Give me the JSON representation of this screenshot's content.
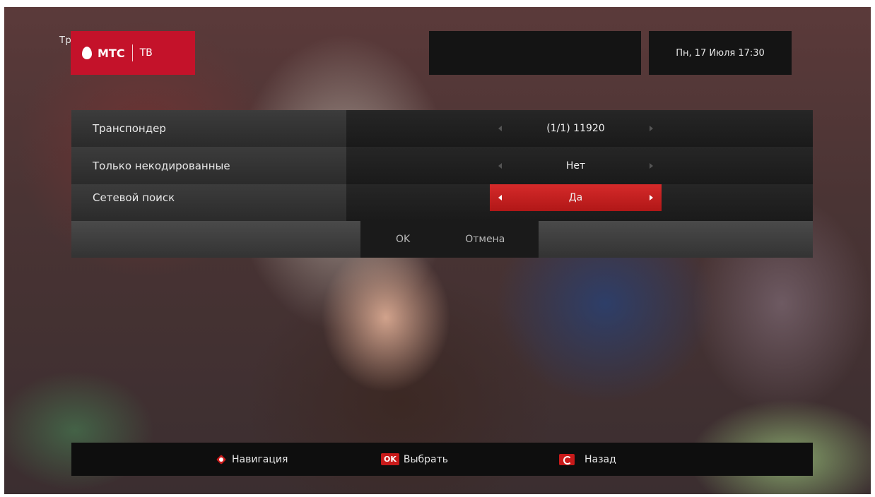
{
  "header": {
    "page_title": "Тр                                ск",
    "logo_brand": "МТС",
    "logo_tv": "ТВ",
    "datetime": "Пн, 17 Июля 17:30"
  },
  "settings": {
    "rows": [
      {
        "label": "Транспондер",
        "value": "(1/1) 11920",
        "active": false
      },
      {
        "label": "Только некодированные",
        "value": "Нет",
        "active": false
      },
      {
        "label": "Сетевой поиск",
        "value": "Да",
        "active": true
      }
    ],
    "ok_label": "OK",
    "cancel_label": "Отмена"
  },
  "footer": {
    "navigation_label": "Навигация",
    "ok_badge": "OK",
    "select_label": "Выбрать",
    "back_label": "Назад"
  },
  "colors": {
    "accent": "#c4122a",
    "active_field": "#c81a1a"
  }
}
